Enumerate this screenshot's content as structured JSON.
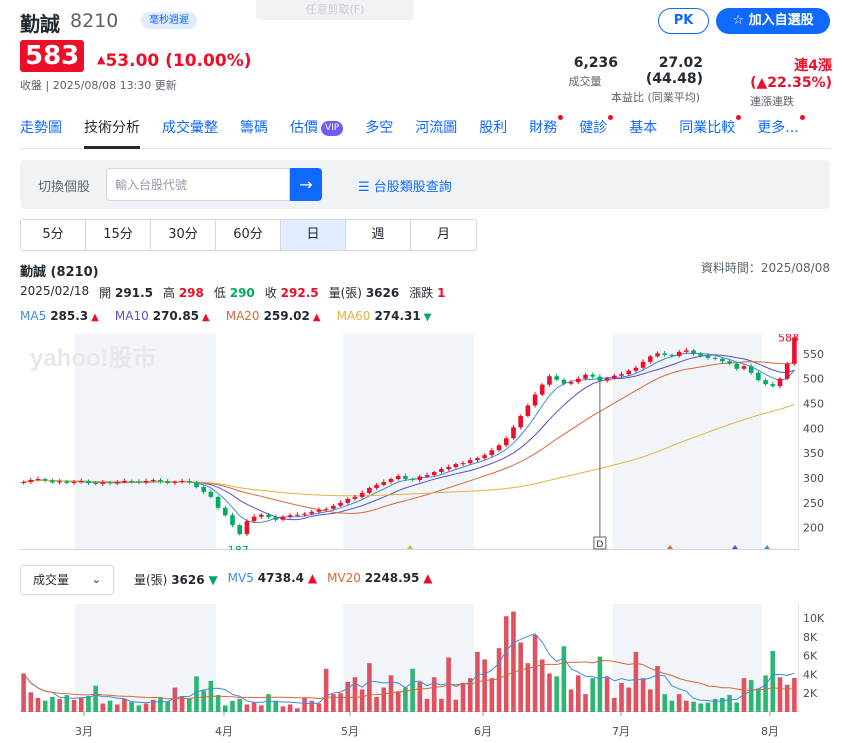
{
  "header": {
    "tooltip_hint": "任意剪取(F)",
    "name": "勤誠",
    "ticker": "8210",
    "delay_badge": "毫秒週遲",
    "pk_label": "PK",
    "watch_label": "加入自選股",
    "price": "583",
    "change": "53.00 (10.00%)",
    "meta": "收盤 | 2025/08/08 13:30 更新",
    "stats": [
      {
        "value": "6,236",
        "label": "成交量"
      },
      {
        "value": "27.02 (44.48)",
        "label": "本益比 (同業平均)"
      },
      {
        "value": "連4漲 (▲22.35%)",
        "label": "連漲連跌"
      }
    ]
  },
  "tabs": [
    {
      "label": "走勢圖",
      "dot": false
    },
    {
      "label": "技術分析",
      "dot": false,
      "active": true
    },
    {
      "label": "成交彙整",
      "dot": false
    },
    {
      "label": "籌碼",
      "dot": false
    },
    {
      "label": "估價",
      "dot": false,
      "vip": "VIP"
    },
    {
      "label": "多空",
      "dot": false
    },
    {
      "label": "河流圖",
      "dot": false
    },
    {
      "label": "股利",
      "dot": false
    },
    {
      "label": "財務",
      "dot": true
    },
    {
      "label": "健診",
      "dot": true
    },
    {
      "label": "基本",
      "dot": false
    },
    {
      "label": "同業比較",
      "dot": true
    },
    {
      "label": "更多...",
      "dot": true
    }
  ],
  "search": {
    "label": "切換個股",
    "placeholder": "輸入台股代號",
    "category_link": "台股類股查詢"
  },
  "periods": [
    "5分",
    "15分",
    "30分",
    "60分",
    "日",
    "週",
    "月"
  ],
  "chart_header": {
    "title": "勤誠 (8210)",
    "data_time": "資料時間：2025/08/08",
    "date": "2025/02/18",
    "open_label": "開",
    "open": "291.5",
    "high_label": "高",
    "high": "298",
    "low_label": "低",
    "low": "290",
    "close_label": "收",
    "close": "292.5",
    "volume_label": "量(張)",
    "volume": "3626",
    "change_label": "漲跌",
    "change": "1",
    "ma": [
      {
        "label": "MA5",
        "value": "285.3",
        "dir": "▲",
        "color": "#3f8bdc"
      },
      {
        "label": "MA10",
        "value": "270.85",
        "dir": "▲",
        "color": "#5b4fc9"
      },
      {
        "label": "MA20",
        "value": "259.02",
        "dir": "▲",
        "color": "#d4693a"
      },
      {
        "label": "MA60",
        "value": "274.31",
        "dir": "▼",
        "color": "#e2b143"
      }
    ]
  },
  "volume_header": {
    "select": "成交量",
    "vol_label": "量(張)",
    "vol": "3626",
    "vol_dir": "▼",
    "mv5_label": "MV5",
    "mv5": "4738.4",
    "mv5_dir": "▲",
    "mv20_label": "MV20",
    "mv20": "2248.95",
    "mv20_dir": "▲"
  },
  "chart_data": {
    "type": "candlestick",
    "watermark": "yahoo!股市",
    "last_price_label": "583",
    "low_label": "187",
    "marker_label": "D",
    "price_axis": {
      "ticks": [
        200,
        250,
        300,
        350,
        400,
        450,
        500,
        550
      ],
      "range": [
        155,
        590
      ]
    },
    "volume_axis": {
      "ticks": [
        "2K",
        "4K",
        "6K",
        "8K",
        "10K"
      ],
      "range": [
        0,
        11500
      ]
    },
    "months": [
      "3月",
      "4月",
      "5月",
      "6月",
      "7月",
      "8月"
    ],
    "closes": [
      292,
      296,
      298,
      295,
      291,
      293,
      290,
      292,
      294,
      290,
      288,
      291,
      289,
      292,
      294,
      293,
      291,
      294,
      296,
      293,
      290,
      292,
      294,
      291,
      282,
      272,
      262,
      240,
      225,
      205,
      187,
      213,
      222,
      226,
      221,
      216,
      222,
      225,
      226,
      228,
      232,
      236,
      238,
      244,
      250,
      258,
      262,
      270,
      280,
      286,
      292,
      298,
      304,
      298,
      296,
      303,
      306,
      312,
      318,
      322,
      328,
      330,
      336,
      340,
      346,
      356,
      366,
      380,
      402,
      425,
      446,
      468,
      488,
      505,
      498,
      490,
      493,
      500,
      508,
      504,
      496,
      501,
      506,
      509,
      516,
      522,
      534,
      545,
      551,
      548,
      546,
      554,
      557,
      550,
      546,
      542,
      540,
      535,
      530,
      520,
      525,
      512,
      497,
      489,
      485,
      500,
      530,
      583
    ],
    "volumes": [
      4100,
      2100,
      1500,
      1200,
      1600,
      1400,
      1800,
      1300,
      1500,
      1700,
      2800,
      900,
      1200,
      800,
      1400,
      1100,
      700,
      900,
      1300,
      1500,
      1100,
      2600,
      1700,
      1400,
      3800,
      2300,
      3300,
      1800,
      700,
      1200,
      1400,
      800,
      1000,
      700,
      1900,
      1200,
      600,
      800,
      400,
      1500,
      1200,
      900,
      4600,
      1900,
      2000,
      3200,
      3700,
      2400,
      5200,
      1600,
      2600,
      3900,
      2200,
      2600,
      4600,
      3200,
      1400,
      3700,
      1400,
      5800,
      1300,
      3100,
      3600,
      6400,
      5600,
      3600,
      6800,
      10200,
      10700,
      7400,
      5200,
      8200,
      5600,
      4100,
      3800,
      7000,
      2400,
      3900,
      1900,
      3600,
      5900,
      3700,
      1500,
      3100,
      2600,
      6400,
      3600,
      2400,
      4900,
      1900,
      1200,
      1900,
      1200,
      1100,
      900,
      1000,
      1400,
      1500,
      1800,
      1000,
      3600,
      3400,
      2500,
      3900,
      6500,
      3700,
      2900,
      3626
    ],
    "ma_series": [
      "MA5",
      "MA10",
      "MA20",
      "MA60"
    ]
  }
}
